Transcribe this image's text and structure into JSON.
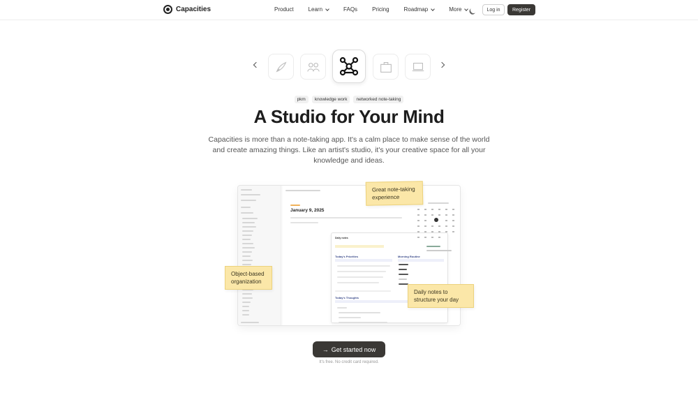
{
  "brand": {
    "name": "Capacities"
  },
  "nav": {
    "links": [
      {
        "label": "Product",
        "has_dropdown": false
      },
      {
        "label": "Learn",
        "has_dropdown": true
      },
      {
        "label": "FAQs",
        "has_dropdown": false
      },
      {
        "label": "Pricing",
        "has_dropdown": false
      },
      {
        "label": "Roadmap",
        "has_dropdown": true
      },
      {
        "label": "More",
        "has_dropdown": true
      }
    ],
    "login": "Log in",
    "register": "Register"
  },
  "carousel": {
    "icons": [
      "rocket-icon",
      "team-icon",
      "network-icon",
      "briefcase-icon",
      "laptop-icon"
    ],
    "active": "network-icon"
  },
  "tags": [
    "pkm",
    "knowledge work",
    "networked note-taking"
  ],
  "hero": {
    "title": "A Studio for Your Mind",
    "subtitle": "Capacities is more than a note-taking app. It's a calm place to make sense of the world and create amazing things. Like an artist's studio, it's your creative space for all your knowledge and ideas."
  },
  "preview": {
    "date": "January 9, 2025",
    "card_title": "Daily notes",
    "sections": [
      "Today's Priorities",
      "Morning Routine",
      "Today's Thoughts"
    ]
  },
  "stickies": {
    "great_notes": "Great note-taking experience",
    "object_based": "Object-based organization",
    "daily_notes": "Daily notes to structure your day"
  },
  "cta": {
    "label": "Get started now",
    "note": "It's free. No credit card required."
  },
  "colors": {
    "dark_button": "#3a3835",
    "sticky": "#fbe7a8"
  }
}
